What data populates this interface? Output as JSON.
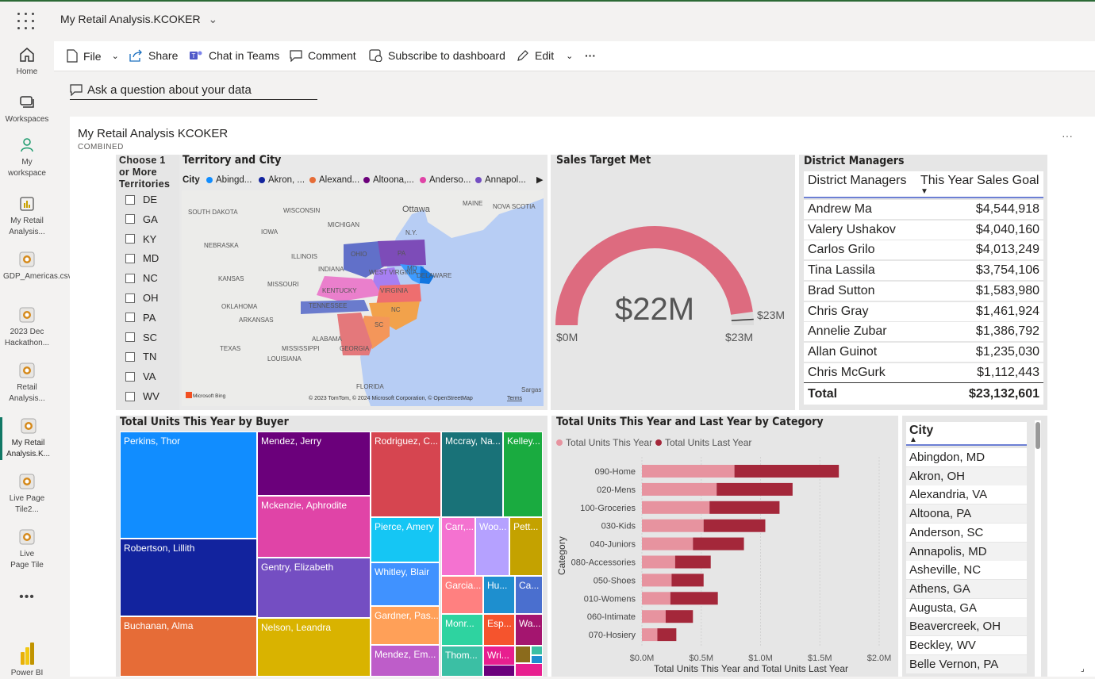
{
  "app": {
    "title": "My Retail Analysis.KCOKER"
  },
  "nav": [
    {
      "label": "Home",
      "icon": "home-icon"
    },
    {
      "label": "Workspaces",
      "icon": "workspaces-icon"
    },
    {
      "label": "My workspace",
      "icon": "person-icon"
    },
    {
      "label": "My Retail Analysis...",
      "icon": "report-icon"
    },
    {
      "label": "GDP_Americas.csv",
      "icon": "dataset-icon"
    },
    {
      "label": "2023 Dec Hackathon...",
      "icon": "dataset-icon"
    },
    {
      "label": "Retail Analysis...",
      "icon": "dataset-icon"
    },
    {
      "label": "My Retail Analysis.K...",
      "icon": "dataset-icon"
    },
    {
      "label": "Live Page Tile2...",
      "icon": "dataset-icon"
    },
    {
      "label": "Live Page Tile",
      "icon": "dataset-icon"
    },
    {
      "label": "Power BI",
      "icon": "powerbi-logo-icon"
    }
  ],
  "toolbar": {
    "file": "File",
    "share": "Share",
    "chat": "Chat in Teams",
    "comment": "Comment",
    "subscribe": "Subscribe to dashboard",
    "edit": "Edit",
    "more": "···"
  },
  "qa": {
    "placeholder": "Ask a question about your data"
  },
  "dashboard": {
    "title": "My Retail Analysis KCOKER",
    "subtitle": "COMBINED",
    "more": "···"
  },
  "slicer": {
    "title": "Choose 1 or More Territories",
    "items": [
      "DE",
      "GA",
      "KY",
      "MD",
      "NC",
      "OH",
      "PA",
      "SC",
      "TN",
      "VA",
      "WV"
    ]
  },
  "map": {
    "title": "Territory and City",
    "legend_label": "City",
    "legend": [
      {
        "name": "Abingd...",
        "color": "#118dff"
      },
      {
        "name": "Akron, ...",
        "color": "#12239e"
      },
      {
        "name": "Alexand...",
        "color": "#e66c37"
      },
      {
        "name": "Altoona,...",
        "color": "#6b007b"
      },
      {
        "name": "Anderso...",
        "color": "#e044a7"
      },
      {
        "name": "Annapol...",
        "color": "#744ec2"
      }
    ],
    "labels": [
      "SOUTH DAKOTA",
      "WISCONSIN",
      "Ottawa",
      "MAINE",
      "NOVA SCOTIA",
      "MICHIGAN",
      "N.Y.",
      "IOWA",
      "NEBRASKA",
      "OHIO",
      "PA",
      "ILLINOIS",
      "INDIANA",
      "KANSAS",
      "MISSOURI",
      "WEST VIRGINIA",
      "MD",
      "DELAWARE",
      "KENTUCKY",
      "VIRGINIA",
      "OKLAHOMA",
      "TENNESSEE",
      "NC",
      "ARKANSAS",
      "SC",
      "ALABAMA",
      "TEXAS",
      "MISSISSIPPI",
      "GEORGIA",
      "LOUISIANA",
      "FLORIDA",
      "Sargas"
    ],
    "attribution": "© 2023 TomTom, © 2024 Microsoft Corporation, © OpenStreetMap",
    "terms": "Terms",
    "bing": "Microsoft Bing"
  },
  "gauge": {
    "title": "Sales Target Met",
    "value_label": "$22M",
    "min_label": "$0M",
    "max_label": "$23M",
    "target_label": "$23M",
    "value": 22,
    "min": 0,
    "max": 23,
    "color": "#dd6b7f"
  },
  "managers": {
    "title": "District Managers",
    "col1": "District Managers",
    "col2": "This Year Sales Goal",
    "rows": [
      {
        "name": "Andrew Ma",
        "goal": "$4,544,918"
      },
      {
        "name": "Valery Ushakov",
        "goal": "$4,040,160"
      },
      {
        "name": "Carlos Grilo",
        "goal": "$4,013,249"
      },
      {
        "name": "Tina Lassila",
        "goal": "$3,754,106"
      },
      {
        "name": "Brad Sutton",
        "goal": "$1,583,980"
      },
      {
        "name": "Chris Gray",
        "goal": "$1,461,924"
      },
      {
        "name": "Annelie Zubar",
        "goal": "$1,386,792"
      },
      {
        "name": "Allan Guinot",
        "goal": "$1,235,030"
      },
      {
        "name": "Chris McGurk",
        "goal": "$1,112,443"
      }
    ],
    "total_label": "Total",
    "total_value": "$23,132,601"
  },
  "treemap": {
    "title": "Total Units This Year by Buyer",
    "cells": [
      {
        "label": "Perkins, Thor",
        "color": "#118dff"
      },
      {
        "label": "Robertson, Lillith",
        "color": "#12239e"
      },
      {
        "label": "Buchanan, Alma",
        "color": "#e66c37"
      },
      {
        "label": "Mendez, Jerry",
        "color": "#6b007b"
      },
      {
        "label": "Mckenzie, Aphrodite",
        "color": "#e044a7"
      },
      {
        "label": "Gentry, Elizabeth",
        "color": "#744ec2"
      },
      {
        "label": "Nelson, Leandra",
        "color": "#d9b300"
      },
      {
        "label": "Rodriguez, C...",
        "color": "#d64550"
      },
      {
        "label": "Mccray, Na...",
        "color": "#197278"
      },
      {
        "label": "Kelley...",
        "color": "#1aab40"
      },
      {
        "label": "Pierce, Amery",
        "color": "#15c6f4"
      },
      {
        "label": "Whitley, Blair",
        "color": "#4092ff"
      },
      {
        "label": "Gardner, Pas...",
        "color": "#ffa058"
      },
      {
        "label": "Mendez, Em...",
        "color": "#be5dc9"
      },
      {
        "label": "Carr,...",
        "color": "#f472d0"
      },
      {
        "label": "Woo...",
        "color": "#b5a1ff"
      },
      {
        "label": "Pett...",
        "color": "#c4a200"
      },
      {
        "label": "Garcia...",
        "color": "#ff8080"
      },
      {
        "label": "Hu...",
        "color": "#1e8fcf"
      },
      {
        "label": "Ca...",
        "color": "#4a6fcf"
      },
      {
        "label": "Monr...",
        "color": "#2ed3a0"
      },
      {
        "label": "Esp...",
        "color": "#f5542d"
      },
      {
        "label": "Wa...",
        "color": "#a4156f"
      },
      {
        "label": "Thom...",
        "color": "#3bbfa4"
      },
      {
        "label": "Wri...",
        "color": "#e81f8f"
      }
    ]
  },
  "barchart": {
    "title": "Total Units This Year and Last Year by Category",
    "xlabel": "Total Units This Year and Total Units Last Year",
    "ylabel": "Category"
  },
  "chart_data": {
    "type": "bar",
    "orientation": "horizontal",
    "stacked": true,
    "categories": [
      "090-Home",
      "020-Mens",
      "100-Groceries",
      "030-Kids",
      "040-Juniors",
      "080-Accessories",
      "050-Shoes",
      "010-Womens",
      "060-Intimate",
      "070-Hosiery"
    ],
    "series": [
      {
        "name": "Total Units This Year",
        "color": "#e7939f",
        "values": [
          0.78,
          0.63,
          0.57,
          0.52,
          0.43,
          0.28,
          0.25,
          0.24,
          0.2,
          0.13
        ]
      },
      {
        "name": "Total Units Last Year",
        "color": "#a4273a",
        "values": [
          0.88,
          0.64,
          0.59,
          0.52,
          0.43,
          0.3,
          0.27,
          0.4,
          0.23,
          0.16
        ]
      }
    ],
    "xticks": [
      "$0.0M",
      "$0.5M",
      "$1.0M",
      "$1.5M",
      "$2.0M"
    ],
    "xlim": [
      0,
      2.0
    ]
  },
  "cities": {
    "header": "City",
    "items": [
      "Abingdon, MD",
      "Akron, OH",
      "Alexandria, VA",
      "Altoona, PA",
      "Anderson, SC",
      "Annapolis, MD",
      "Asheville, NC",
      "Athens, GA",
      "Augusta, GA",
      "Beavercreek, OH",
      "Beckley, WV",
      "Belle Vernon, PA"
    ]
  }
}
